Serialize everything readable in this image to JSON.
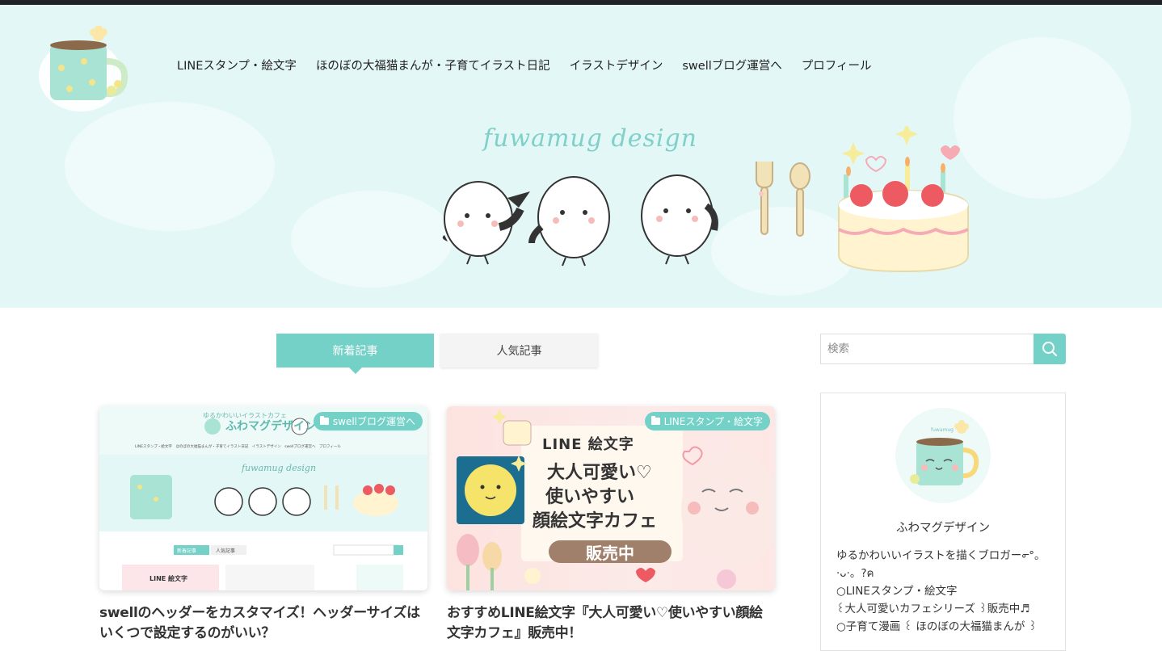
{
  "nav": {
    "items": [
      {
        "label": "LINEスタンプ・絵文字"
      },
      {
        "label": "ほのぼの大福猫まんが・子育てイラスト日記"
      },
      {
        "label": "イラストデザイン"
      },
      {
        "label": "swellブログ運営へ"
      },
      {
        "label": "プロフィール"
      }
    ]
  },
  "header": {
    "brand_script": "fuwamug design"
  },
  "tabs": {
    "new_label": "新着記事",
    "popular_label": "人気記事"
  },
  "posts": [
    {
      "category": "swellブログ運営へ",
      "title": "swellのヘッダーをカスタマイズ！ヘッダーサイズはいくつで設定するのがいい？",
      "thumb": {
        "site_name": "ふわマグデザイン",
        "tagline": "ゆるかわいいイラストカフェ",
        "script": "fuwamug design",
        "mini_nav": "LINEスタンプ・絵文字　ほのぼの大福猫まんが・子育てイラスト日記　イラストデザイン　swellブログ運営へ　プロフィール",
        "mini_tab_new": "新着記事",
        "mini_tab_pop": "人気記事",
        "mini_line": "LINE 絵文字"
      }
    },
    {
      "category": "LINEスタンプ・絵文字",
      "title": "おすすめLINE絵文字『大人可愛い♡使いやすい顔絵文字カフェ』販売中！",
      "thumb": {
        "line_label": "LINE 絵文字",
        "line1": "大人可愛い♡",
        "line2": "使いやすい",
        "line3": "顔絵文字カフェ",
        "sale": "販売中"
      }
    }
  ],
  "search": {
    "placeholder": "検索"
  },
  "profile": {
    "name": "ふわマグデザイン",
    "mug_label": "fuwamug",
    "description": "ゆるかわいいイラストを描くブロガー൳°。\n·ᴗ·。?ค\n○LINEスタンプ・絵文字\n꒰大人可愛いカフェシリーズ ꒱販売中♬\n○子育て漫画 ꒰ ほのぼの大福猫まんが ꒱"
  },
  "colors": {
    "accent": "#74d1c8",
    "header_bg": "#e2f7f6",
    "topbar": "#1f2326"
  }
}
